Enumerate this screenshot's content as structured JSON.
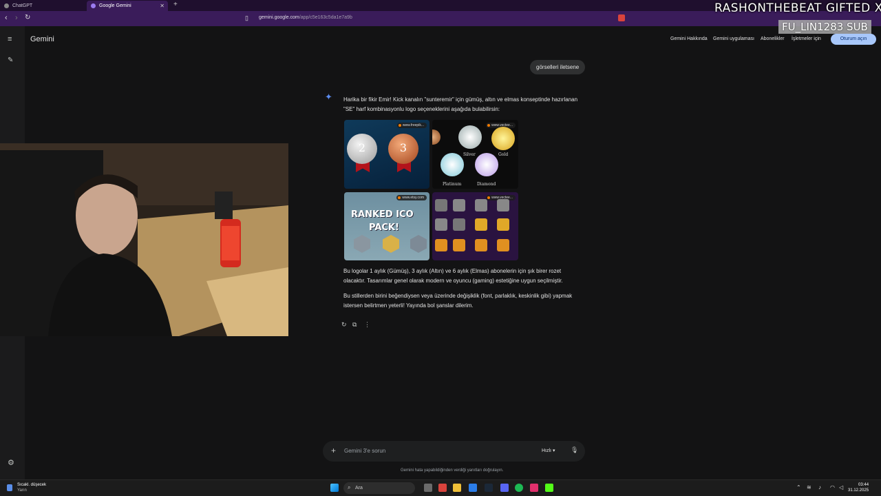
{
  "browser": {
    "tabs": [
      {
        "label": "ChatGPT"
      },
      {
        "label": "Google Gemini"
      }
    ],
    "url_host": "gemini.google.com",
    "url_path": "/app/c5e163c5da1e7a9b"
  },
  "overlay": {
    "title": "RASHONTHEBEAT  GIFTED X1",
    "sub": "FU_LIN1283  SUB"
  },
  "app": {
    "name": "Gemini",
    "top_links": [
      "Gemini Hakkında",
      "Gemini uygulaması",
      "Abonelikler",
      "İşletmeler için"
    ],
    "signin_label": "Oturum açın"
  },
  "chat": {
    "user_message": "görselleri iletsene",
    "response_intro_1": "Harika bir fikir Emir! Kick kanalın \"sunteremir\" için gümüş, altın ve elmas konseptinde hazırlanan",
    "response_intro_2": "\"SE\" harf kombinasyonlu logo seçeneklerini aşağıda bulabilirsin:",
    "images": [
      {
        "source": "www.freepik..."
      },
      {
        "source": "www.vectee..."
      },
      {
        "source": "www.etsy.com"
      },
      {
        "source": "www.vectee..."
      }
    ],
    "medal_numbers": [
      "2",
      "3"
    ],
    "rank_labels": [
      "Silver",
      "Gold",
      "Platinum",
      "Diamond"
    ],
    "ranked_text_1": "RANKED ICO",
    "ranked_text_2": "PACK!",
    "response_p2_1": "Bu logolar 1 aylık (Gümüş), 3 aylık (Altın) ve 6 aylık (Elmas) abonelerin için şık birer rozet",
    "response_p2_2": "olacaktır. Tasarımlar genel olarak modern ve oyuncu (gaming) estetiğine uygun seçilmiştir.",
    "response_p3_1": "Bu stillerden birini beğendiysen veya üzerinde değişiklik (font, parlaklık, keskinlik gibi) yapmak",
    "response_p3_2": "istersen belirtmen yeterli! Yayında bol şanslar dilerim."
  },
  "input": {
    "placeholder": "Gemini 3'e sorun",
    "mode": "Hızlı"
  },
  "disclaimer": "Gemini hata yapabildiğinden verdiği yanıtları doğrulayın.",
  "taskbar": {
    "weather_title": "Sıcakl. düşecek",
    "weather_sub": "Yarın",
    "search_label": "Ara",
    "time": "03:44",
    "date": "31.12.2025"
  },
  "colors": {
    "accent_button": "#a8c7fa",
    "browser_frame": "#3a1c5a",
    "page_bg": "#131314",
    "gemini_spark": "#5b8cf0"
  },
  "icons": [
    "menu-icon",
    "edit-icon",
    "settings-icon",
    "sparkle-icon",
    "refresh-icon",
    "copy-icon",
    "more-icon",
    "plus-icon",
    "mic-icon"
  ]
}
